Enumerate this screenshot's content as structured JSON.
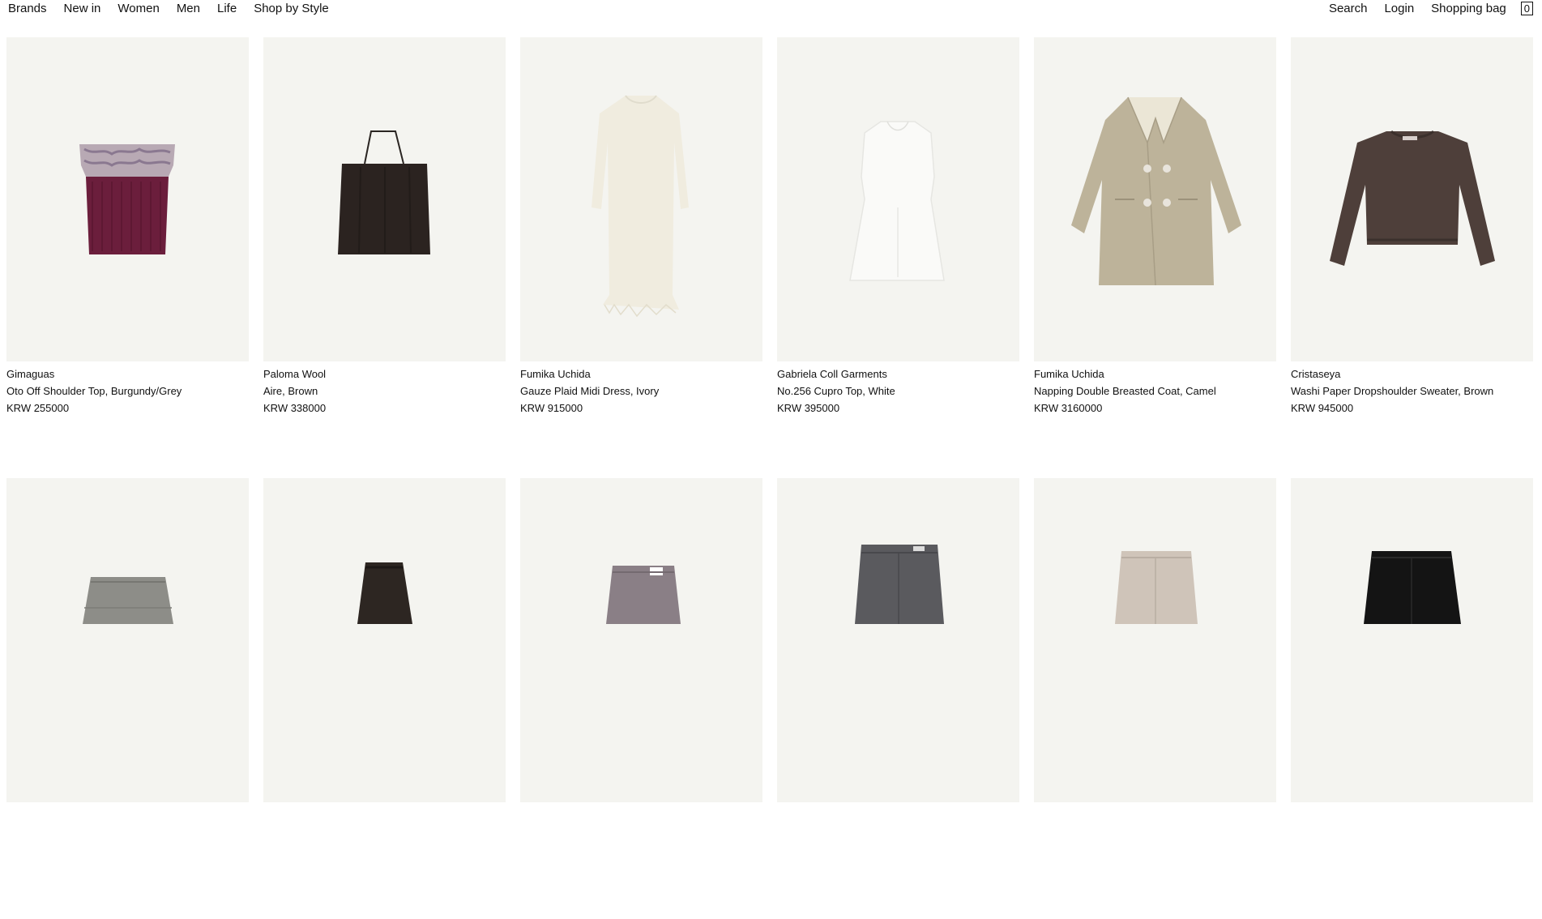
{
  "nav": {
    "left": [
      "Brands",
      "New in",
      "Women",
      "Men",
      "Life",
      "Shop by Style"
    ],
    "search": "Search",
    "login": "Login",
    "bag": "Shopping bag",
    "bag_count": "0"
  },
  "products": [
    {
      "brand": "Gimaguas",
      "name": "Oto Off Shoulder Top, Burgundy/Grey",
      "price": "KRW 255000"
    },
    {
      "brand": "Paloma Wool",
      "name": "Aire, Brown",
      "price": "KRW 338000"
    },
    {
      "brand": "Fumika Uchida",
      "name": "Gauze Plaid Midi Dress, Ivory",
      "price": "KRW 915000"
    },
    {
      "brand": "Gabriela Coll Garments",
      "name": "No.256 Cupro Top, White",
      "price": "KRW 395000"
    },
    {
      "brand": "Fumika Uchida",
      "name": "Napping Double Breasted Coat, Camel",
      "price": "KRW 3160000"
    },
    {
      "brand": "Cristaseya",
      "name": "Washi Paper Dropshoulder Sweater, Brown",
      "price": "KRW 945000"
    }
  ],
  "colors": {
    "image_bg": "#f4f4f0",
    "text": "#111111"
  }
}
